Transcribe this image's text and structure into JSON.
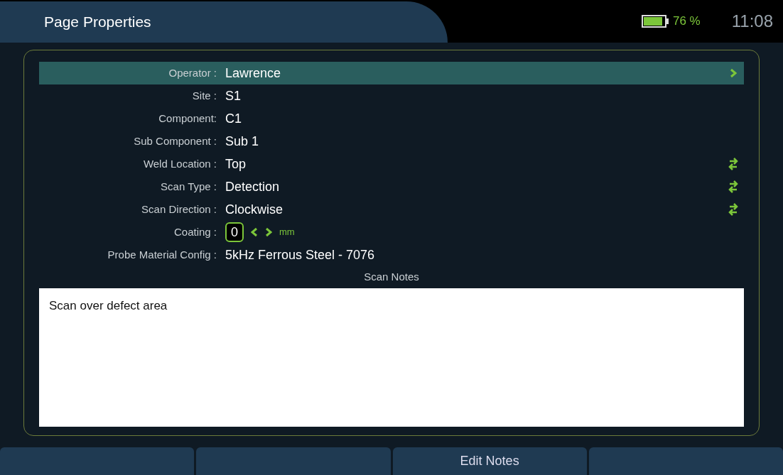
{
  "header": {
    "title": "Page Properties",
    "battery": "76 %",
    "time": "11:08"
  },
  "fields": [
    {
      "kind": "text",
      "label": "Operator :",
      "value": "Lawrence",
      "selected": true,
      "action": {
        "kind": "next"
      }
    },
    {
      "kind": "text",
      "label": "Site :",
      "value": "S1",
      "selected": false
    },
    {
      "kind": "text",
      "label": "Component:",
      "value": "C1",
      "selected": false
    },
    {
      "kind": "text",
      "label": "Sub Component :",
      "value": "Sub 1",
      "selected": false
    },
    {
      "kind": "text",
      "label": "Weld Location :",
      "value": "Top",
      "selected": false,
      "action": {
        "kind": "toggle"
      }
    },
    {
      "kind": "text",
      "label": "Scan Type :",
      "value": "Detection",
      "selected": false,
      "action": {
        "kind": "toggle"
      }
    },
    {
      "kind": "text",
      "label": "Scan Direction :",
      "value": "Clockwise",
      "selected": false,
      "action": {
        "kind": "toggle"
      }
    },
    {
      "kind": "stepper",
      "label": "Coating :",
      "value": "0",
      "unit": "mm",
      "selected": false
    },
    {
      "kind": "text",
      "label": "Probe Material Config :",
      "value": "5kHz Ferrous Steel - 7076",
      "selected": false
    }
  ],
  "notes": {
    "label": "Scan Notes",
    "text": "Scan over defect area"
  },
  "softkeys": [
    {
      "kind": "blank"
    },
    {
      "kind": "blank"
    },
    {
      "kind": "labeled",
      "label": "Edit Notes"
    },
    {
      "kind": "blank"
    }
  ]
}
